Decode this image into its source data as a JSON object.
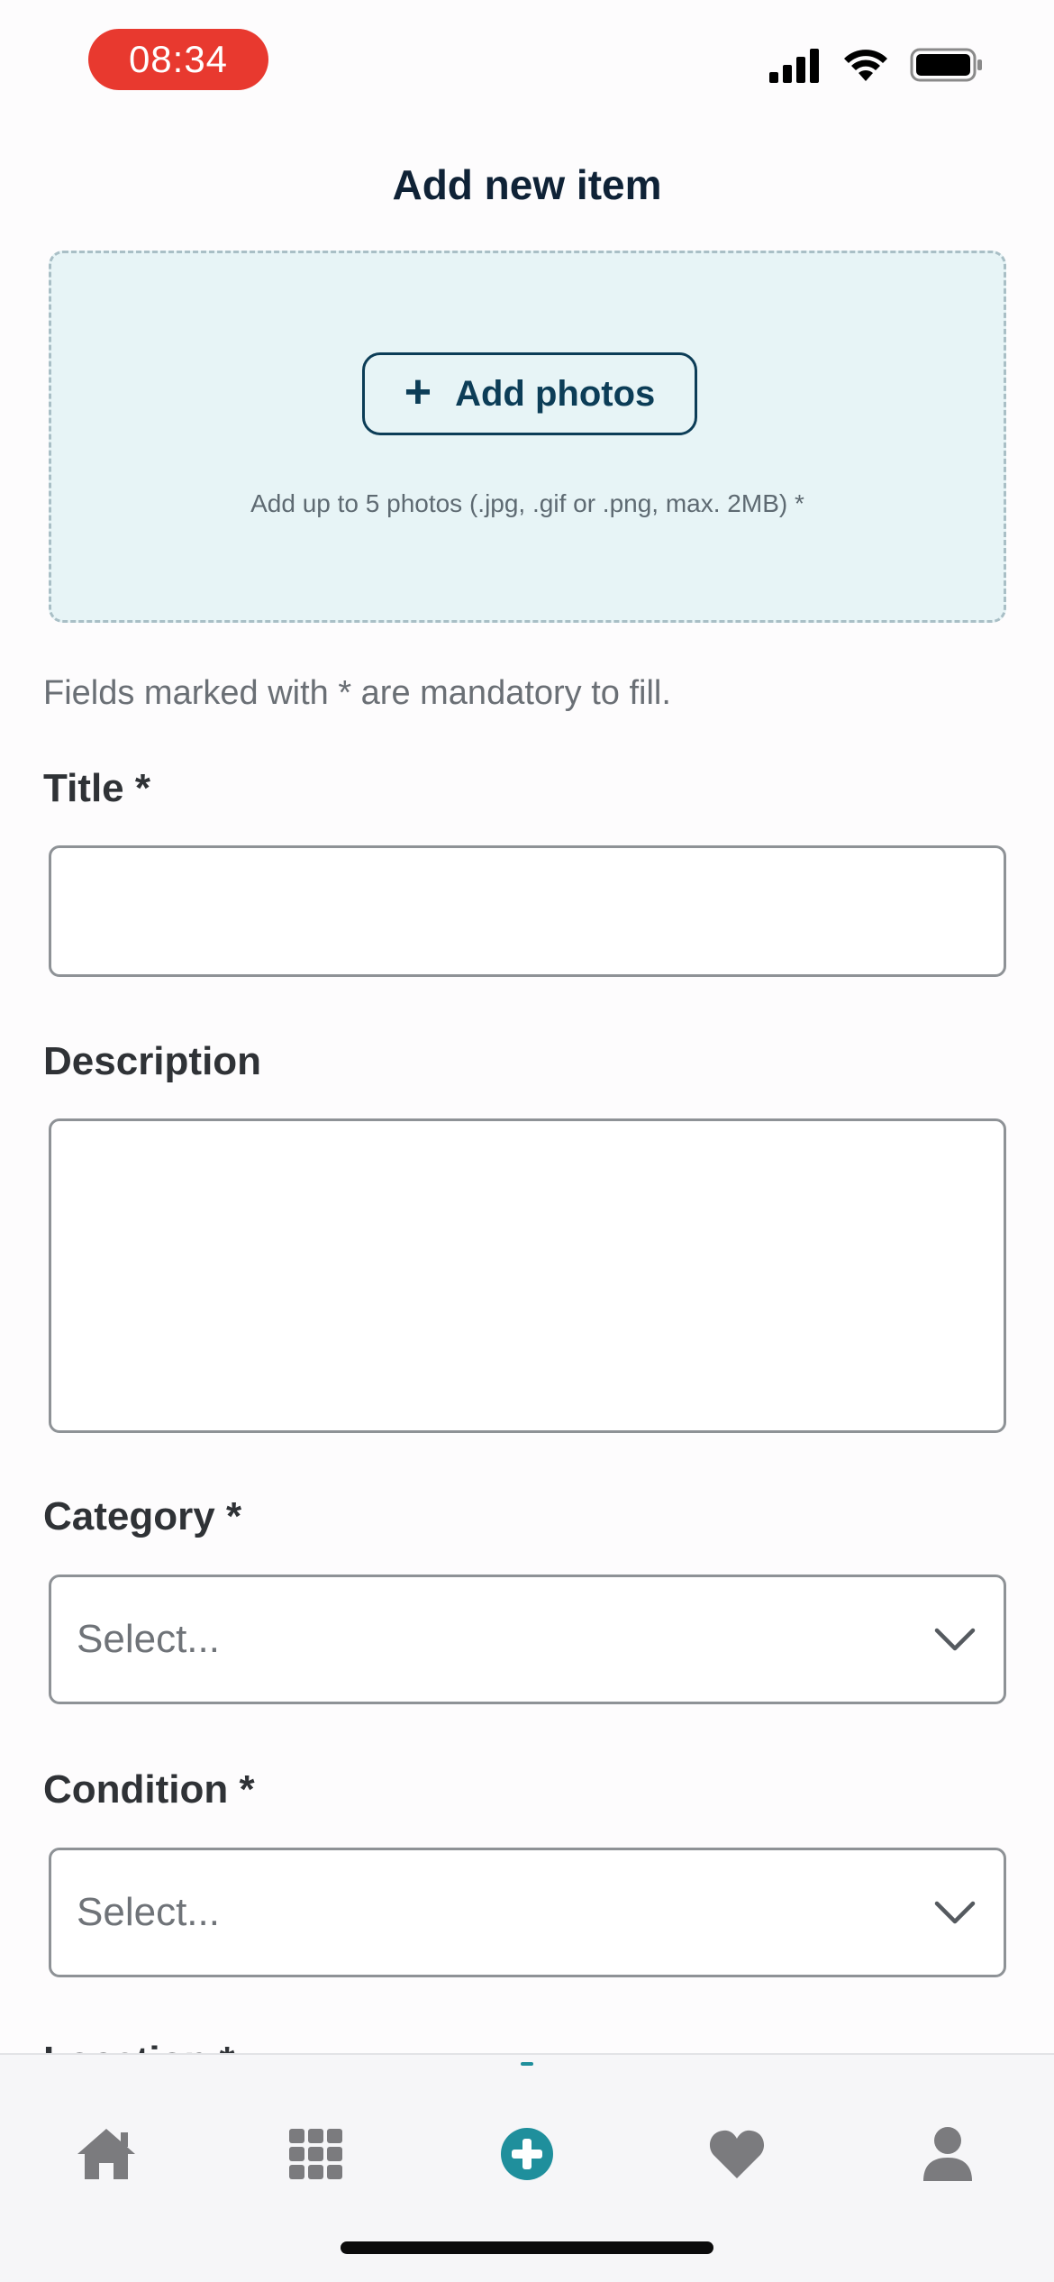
{
  "status_bar": {
    "time": "08:34"
  },
  "header": {
    "title": "Add new item"
  },
  "photos": {
    "button_label": "Add photos",
    "hint": "Add up to 5 photos (.jpg, .gif or .png, max. 2MB) *"
  },
  "form": {
    "mandatory_note": "Fields marked with * are mandatory to fill.",
    "title_label": "Title *",
    "title_value": "",
    "description_label": "Description",
    "description_value": "",
    "category_label": "Category *",
    "category_value": "Select...",
    "condition_label": "Condition *",
    "condition_value": "Select...",
    "location_label": "Location *"
  },
  "nav": {
    "items": [
      "home",
      "categories",
      "add-item",
      "favorites",
      "profile"
    ],
    "active": "add-item",
    "active_color": "#1f8f9c",
    "inactive_color": "#7b7b7e"
  }
}
